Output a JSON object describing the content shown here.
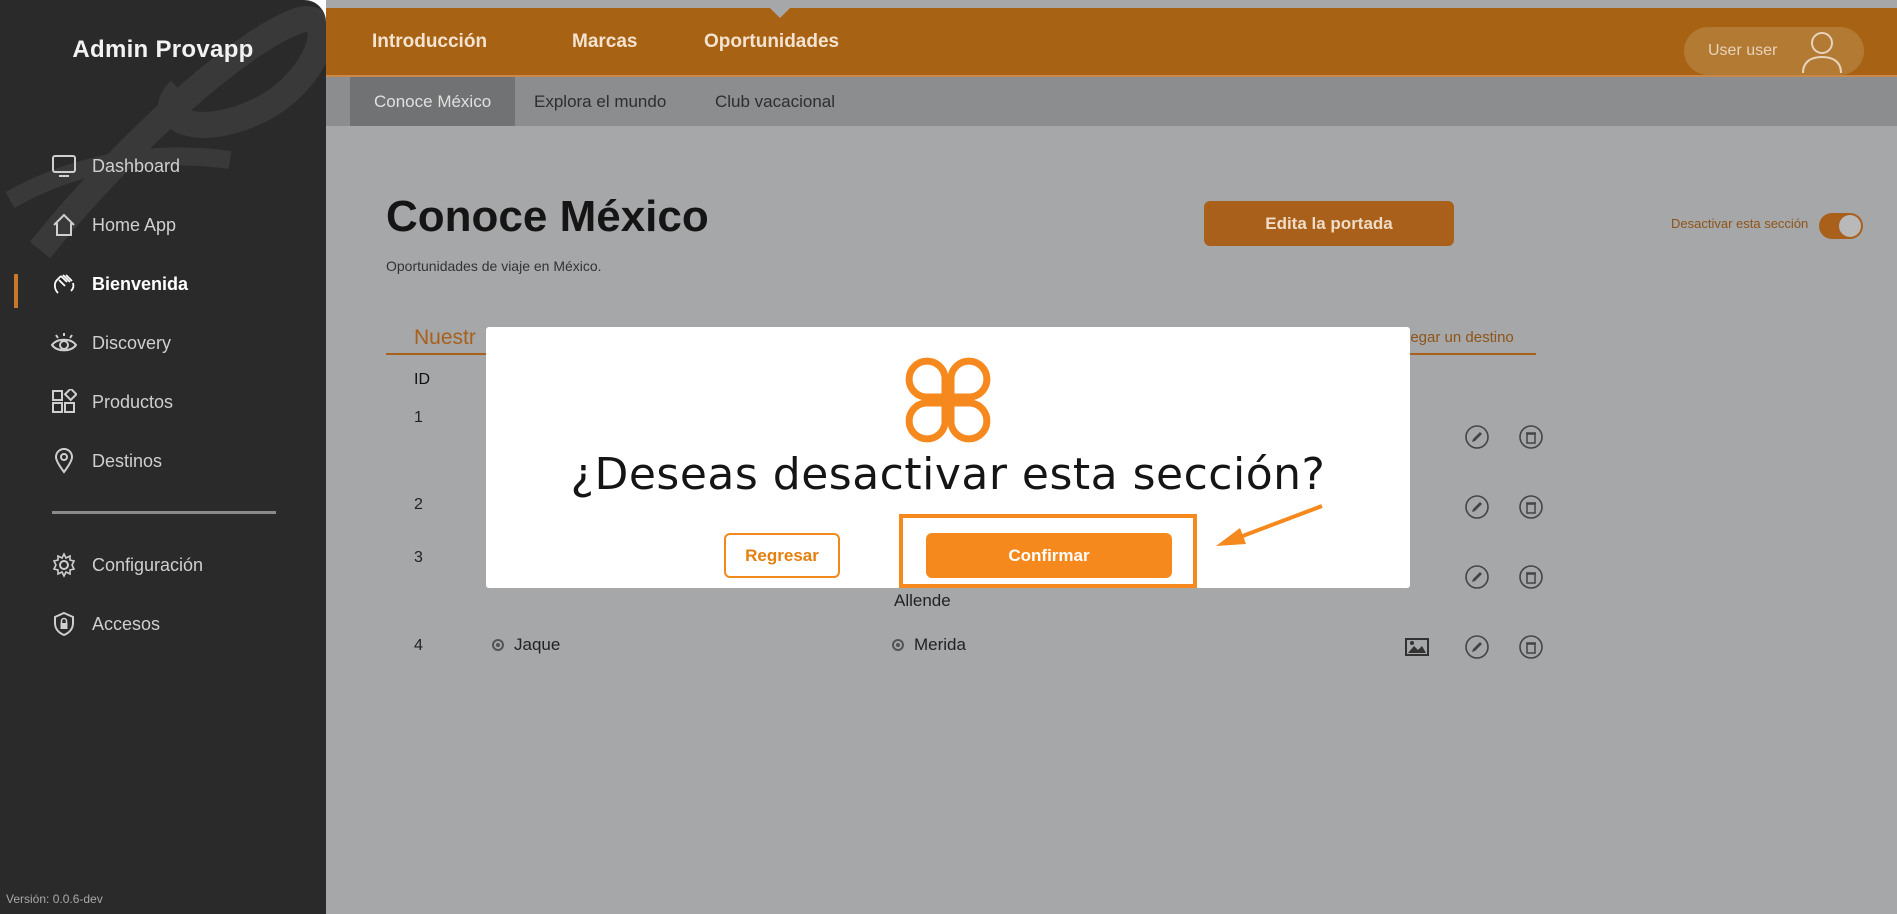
{
  "sidebar": {
    "brand": "Admin Provapp",
    "items": [
      {
        "label": "Dashboard",
        "icon": "monitor-icon"
      },
      {
        "label": "Home App",
        "icon": "home-icon"
      },
      {
        "label": "Bienvenida",
        "icon": "wave-hand-icon",
        "active": true
      },
      {
        "label": "Discovery",
        "icon": "eye-icon"
      },
      {
        "label": "Productos",
        "icon": "grid-shapes-icon"
      },
      {
        "label": "Destinos",
        "icon": "map-pin-icon"
      }
    ],
    "secondary": [
      {
        "label": "Configuración",
        "icon": "gear-icon"
      },
      {
        "label": "Accesos",
        "icon": "shield-lock-icon"
      }
    ],
    "version": "Versión: 0.0.6-dev"
  },
  "topnav": {
    "links": [
      "Introducción",
      "Marcas",
      "Oportunidades"
    ],
    "user": "User user"
  },
  "subnav": {
    "tabs": [
      "Conoce México",
      "Explora el mundo",
      "Club vacacional"
    ]
  },
  "page": {
    "title": "Conoce México",
    "subtitle": "Oportunidades de viaje en México.",
    "edit_button": "Edita la portada",
    "toggle_label": "Desactivar esta sección",
    "toggle_on": true,
    "section_tab": "Nuestr",
    "add_destination": "gregar un destino",
    "table": {
      "id_header": "ID",
      "rows": [
        {
          "id": "1"
        },
        {
          "id": "2"
        },
        {
          "id": "3",
          "col2_tail": "Allende"
        },
        {
          "id": "4",
          "col1": "Jaque",
          "col2": "Merida"
        }
      ]
    }
  },
  "modal": {
    "title": "¿Deseas desactivar esta sección?",
    "back_button": "Regresar",
    "confirm_button": "Confirmar"
  },
  "colors": {
    "accent": "#f5891e",
    "topbar": "#a86213",
    "sidebar": "#2a2a2a"
  }
}
